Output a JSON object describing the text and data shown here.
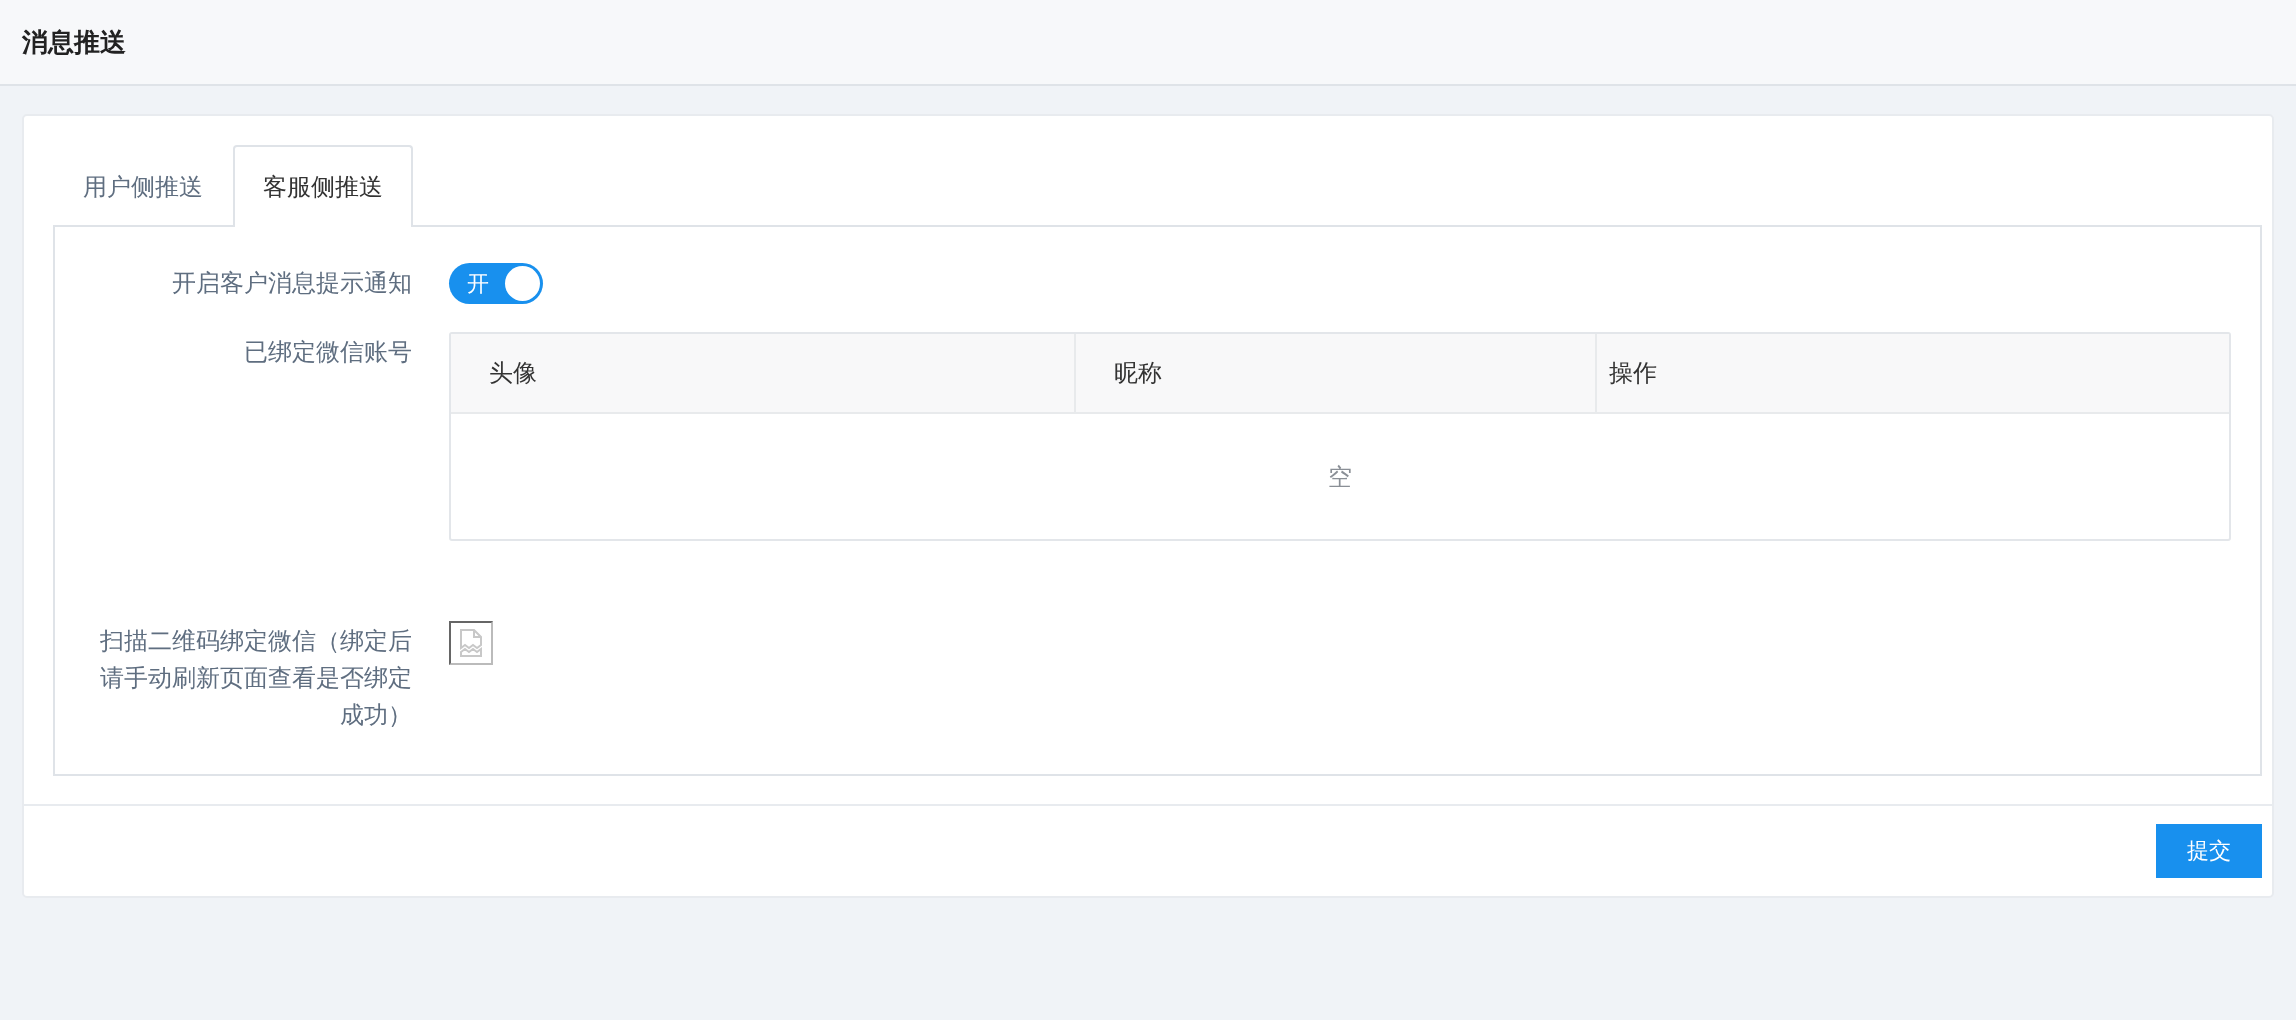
{
  "header": {
    "title": "消息推送"
  },
  "tabs": [
    {
      "label": "用户侧推送",
      "selected": false
    },
    {
      "label": "客服侧推送",
      "selected": true
    }
  ],
  "form": {
    "fields": [
      {
        "kind": "switch",
        "label": "开启客户消息提示通知",
        "on": true,
        "switch_text": "开"
      },
      {
        "kind": "table",
        "label": "已绑定微信账号",
        "columns": [
          "头像",
          "昵称",
          "操作"
        ],
        "empty_text": "空"
      },
      {
        "kind": "image",
        "label": "扫描二维码绑定微信（绑定后请手动刷新页面查看是否绑定成功）"
      }
    ]
  },
  "submit_button": "提交"
}
